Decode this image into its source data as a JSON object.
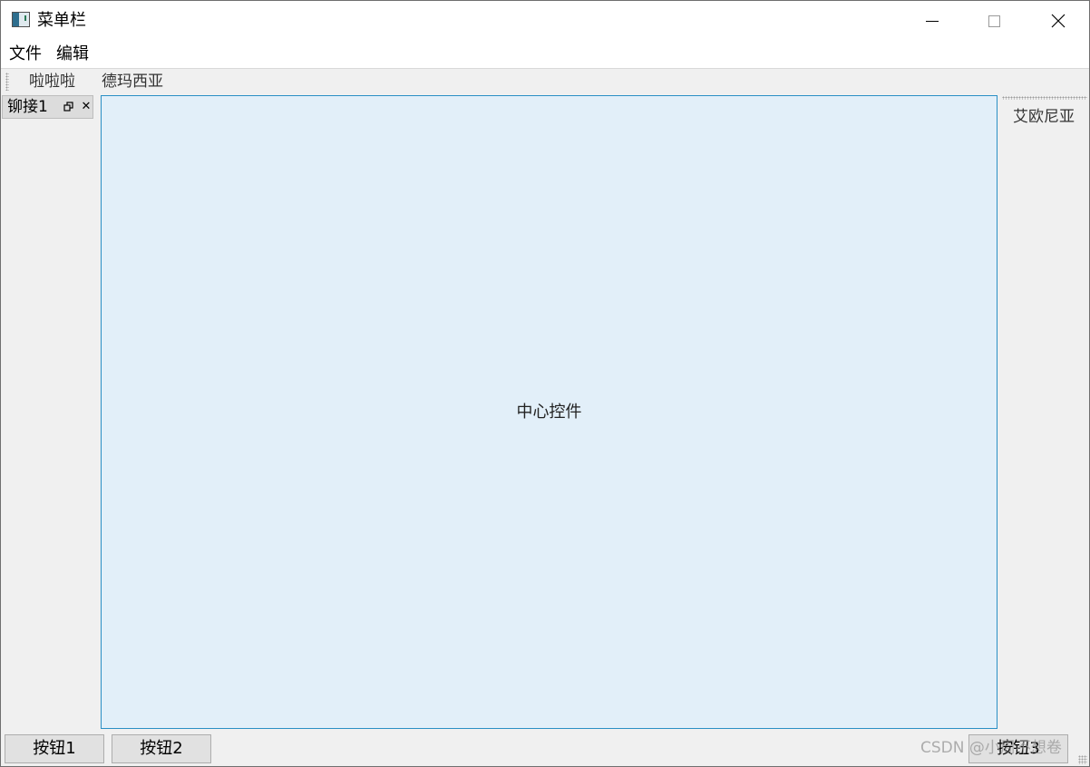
{
  "window": {
    "title": "菜单栏",
    "icon": "app-window-icon",
    "controls": [
      "minimize-icon",
      "maximize-icon",
      "close-icon"
    ]
  },
  "menubar": {
    "items": [
      {
        "label": "文件"
      },
      {
        "label": "编辑"
      }
    ]
  },
  "toolbar": {
    "items": [
      {
        "label": "啦啦啦"
      },
      {
        "label": "德玛西亚"
      }
    ]
  },
  "dock": {
    "title": "铆接1",
    "float_icon": "float-icon",
    "close_icon": "close-icon"
  },
  "central": {
    "label": "中心控件",
    "background": "#e2eff9",
    "border": "#2a8fc5"
  },
  "right_toolbar": {
    "items": [
      {
        "label": "艾欧尼亚"
      }
    ]
  },
  "bottom_toolbar": {
    "buttons": [
      {
        "label": "按钮1"
      },
      {
        "label": "按钮2"
      },
      {
        "label": "按钮3"
      }
    ]
  },
  "watermark": "CSDN @小周不想卷"
}
